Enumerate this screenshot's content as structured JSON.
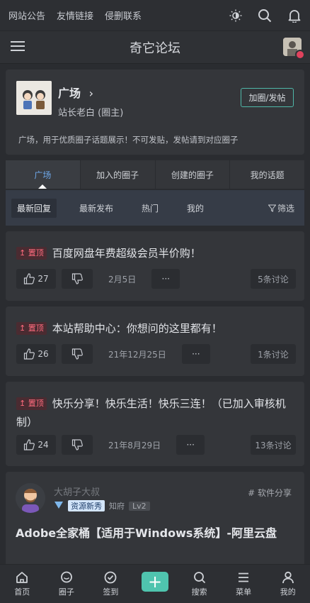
{
  "topbar": {
    "links": [
      "网站公告",
      "友情链接",
      "侵删联系"
    ]
  },
  "titlebar": {
    "title": "奇它论坛"
  },
  "forum": {
    "name": "广场",
    "owner": "站长老白 (圈主)",
    "join_label": "加圈/发帖",
    "description": "广场，用于优质圈子话题展示！不可发贴，发帖请到对应圈子"
  },
  "tabs": [
    "广场",
    "加入的圈子",
    "创建的圈子",
    "我的话题"
  ],
  "subtabs": [
    "最新回复",
    "最新发布",
    "热门",
    "我的"
  ],
  "filter_label": "筛选",
  "posts": [
    {
      "badge": "置顶",
      "title": "百度网盘年费超级会员半价购！",
      "likes": "27",
      "date": "2月5日",
      "more": "···",
      "comments": "5条讨论"
    },
    {
      "badge": "置顶",
      "title": "本站帮助中心：你想问的这里都有！",
      "likes": "26",
      "date": "21年12月25日",
      "more": "···",
      "comments": "1条讨论"
    },
    {
      "badge": "置顶",
      "title": "快乐分享！快乐生活！快乐三连！（已加入审核机制）",
      "likes": "24",
      "date": "21年8月29日",
      "more": "···",
      "comments": "13条讨论"
    }
  ],
  "feed": {
    "username": "大胡子大叔",
    "rank": "资源新秀",
    "role": "知府",
    "level": "Lv2",
    "category": "# 软件分享",
    "headline": "Adobe全家桶【适用于Windows系统】-阿里云盘"
  },
  "bottomnav": {
    "home": "首页",
    "circle": "圈子",
    "checkin": "签到",
    "plus": "+",
    "search": "搜索",
    "menu": "菜单",
    "mine": "我的"
  },
  "colors": {
    "accent": "#4fc4ae",
    "tab_active": "#6fa9ea",
    "badge": "#ff6b7d"
  }
}
